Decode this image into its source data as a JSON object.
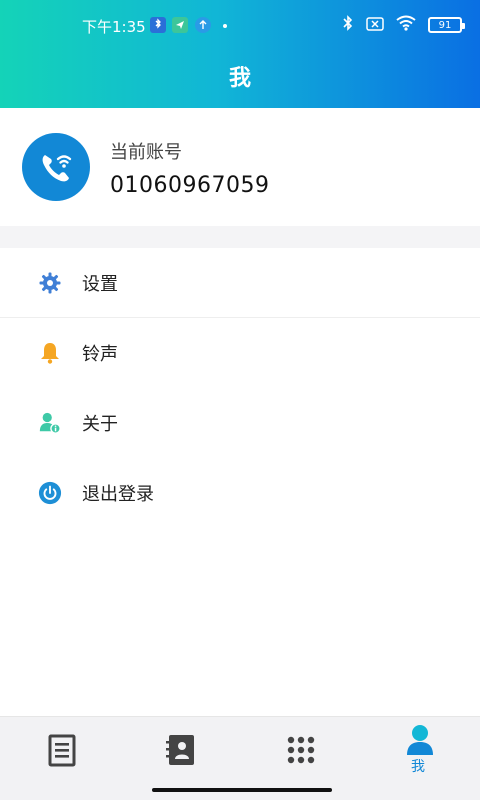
{
  "status_bar": {
    "time": "下午1:35",
    "battery": "91",
    "icons": [
      "bluetooth-app-icon",
      "location-app-icon",
      "upload-app-icon",
      "bluetooth-icon",
      "no-sim-icon",
      "wifi-icon",
      "battery-icon"
    ]
  },
  "header": {
    "title": "我"
  },
  "account": {
    "label": "当前账号",
    "number": "01060967059",
    "avatar_icon": "phone-wifi-icon"
  },
  "menu": {
    "items": [
      {
        "label": "设置",
        "icon": "gear-icon",
        "color": "#3f7fd6"
      },
      {
        "label": "铃声",
        "icon": "bell-icon",
        "color": "#f5a623"
      },
      {
        "label": "关于",
        "icon": "person-info-icon",
        "color": "#3ec9a7"
      },
      {
        "label": "退出登录",
        "icon": "power-icon",
        "color": "#1e8fd6"
      }
    ]
  },
  "bottom_nav": {
    "items": [
      {
        "icon": "call-log-icon"
      },
      {
        "icon": "contacts-icon"
      },
      {
        "icon": "dialpad-icon"
      },
      {
        "icon": "me-icon",
        "label": "我"
      }
    ]
  },
  "colors": {
    "accent": "#1288d6",
    "gradient_start": "#14d3b8",
    "gradient_end": "#0a6fe3"
  }
}
